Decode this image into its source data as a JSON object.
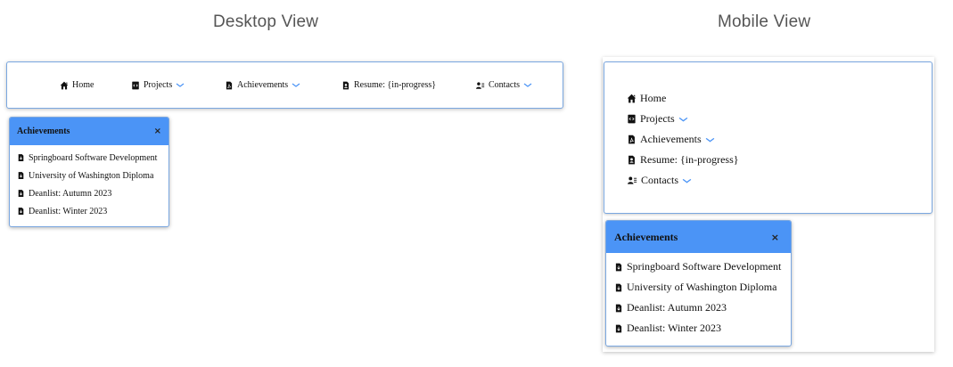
{
  "captions": {
    "desktop": "Desktop View",
    "mobile": "Mobile View"
  },
  "nav": {
    "items": [
      {
        "label": "Home",
        "icon": "home-icon",
        "dropdown": false
      },
      {
        "label": "Projects",
        "icon": "code-file-icon",
        "dropdown": true
      },
      {
        "label": "Achievements",
        "icon": "pdf-file-icon",
        "dropdown": true
      },
      {
        "label": "Resume: {in-progress}",
        "icon": "resume-icon",
        "dropdown": false
      },
      {
        "label": "Contacts",
        "icon": "contacts-icon",
        "dropdown": true
      }
    ]
  },
  "achievements_panel": {
    "title": "Achievements",
    "close_label": "×",
    "items": [
      "Springboard Software Development",
      "University of Washington Diploma",
      "Deanlist: Autumn 2023",
      "Deanlist: Winter 2023"
    ]
  },
  "colors": {
    "accent": "#4b94f6",
    "border": "#7aa7e0",
    "caption": "#555555",
    "chevron": "#4b94f6"
  }
}
